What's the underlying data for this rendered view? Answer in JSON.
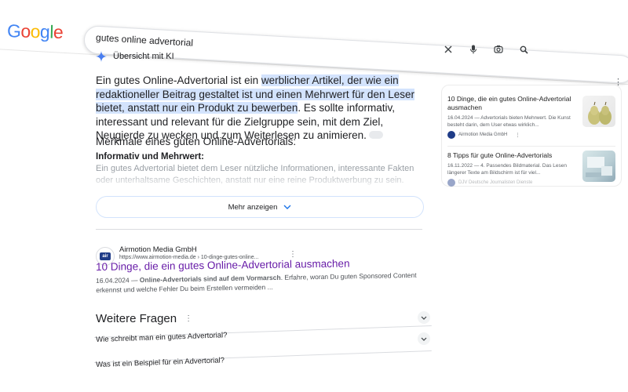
{
  "logo": {
    "letters": [
      "G",
      "o",
      "o",
      "g",
      "l",
      "e"
    ],
    "colors": [
      "#4285F4",
      "#EA4335",
      "#FBBC05",
      "#4285F4",
      "#34A853",
      "#EA4335"
    ]
  },
  "search": {
    "query": "gutes online advertorial"
  },
  "ai_overview": {
    "header": "Übersicht mit KI",
    "intro_plain_1": "Ein gutes Online-Advertorial ist ein ",
    "intro_highlight": "werblicher Artikel, der wie ein redaktioneller Beitrag gestaltet ist und einen Mehrwert für den Leser bietet, anstatt nur ein Produkt zu bewerben",
    "intro_plain_2": ". Es sollte informativ, interessant und relevant für die Zielgruppe sein, mit dem Ziel, Neugierde zu wecken und zum Weiterlesen zu animieren.",
    "subheading": "Merkmale eines guten Online-Advertorials:",
    "point_title": "Informativ und Mehrwert:",
    "point_text": "Ein gutes Advertorial bietet dem Leser nützliche Informationen, interessante Fakten oder unterhaltsame Geschichten, anstatt nur eine reine Produktwerbung zu sein.",
    "more_button": "Mehr anzeigen"
  },
  "source_cards": [
    {
      "title": "10 Dinge, die ein gutes Online-Advertorial ausmachen",
      "desc": "16.04.2024 — Advertorials bieten Mehrwert. Die Kunst besteht darin, dem User etwas wirklich...",
      "site": "Airmotion Media GmbH"
    },
    {
      "title": "8 Tipps für gute Online-Advertorials",
      "desc": "16.11.2022 — 4. Passendes Bildmaterial. Das Lesen längerer Texte am Bildschirm ist für viel...",
      "site": "DJV Deutsche Journalisten Dienste"
    }
  ],
  "result": {
    "site_name": "Airmotion Media GmbH",
    "url": "https://www.airmotion-media.de › 10-dinge-gutes-online...",
    "favicon_text": "air",
    "title": "10 Dinge, die ein gutes Online-Advertorial ausmachen",
    "snippet_date": "16.04.2024 — ",
    "snippet_bold": "Online-Advertorials sind auf dem Vormarsch",
    "snippet_rest": ". Erfahre, woran Du guten Sponsored Content erkennst und welche Fehler Du beim Erstellen vermeiden ..."
  },
  "people_also_ask": {
    "heading": "Weitere Fragen",
    "questions": [
      "Wie schreibt man ein gutes Advertorial?",
      "Was ist ein Beispiel für ein Advertorial?"
    ]
  }
}
